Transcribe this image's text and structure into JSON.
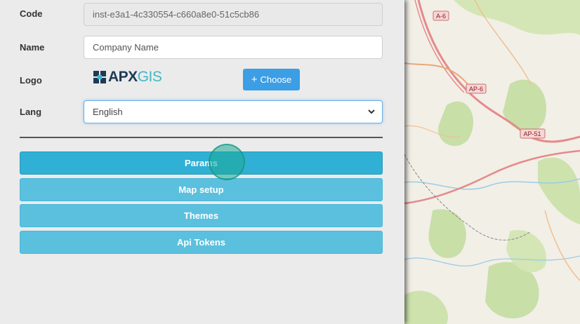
{
  "form": {
    "code": {
      "label": "Code",
      "value": "inst-e3a1-4c330554-c660a8e0-51c5cb86"
    },
    "name": {
      "label": "Name",
      "placeholder": "Company Name"
    },
    "logo": {
      "label": "Logo",
      "brand_main": "APX",
      "brand_accent": "GIS",
      "choose_label": "Choose",
      "choose_icon": "plus-icon"
    },
    "lang": {
      "label": "Lang",
      "selected": "English"
    }
  },
  "actions": [
    {
      "label": "Params"
    },
    {
      "label": "Map setup"
    },
    {
      "label": "Themes"
    },
    {
      "label": "Api Tokens"
    }
  ],
  "map": {
    "road_labels": [
      "A-6",
      "AP-6",
      "AP-51"
    ]
  },
  "colors": {
    "primary_button": "#3c9ee5",
    "action_button": "#5bc0de",
    "action_active": "#31b0d5",
    "road": "#e58a8a",
    "forest": "#c8dfa8"
  }
}
